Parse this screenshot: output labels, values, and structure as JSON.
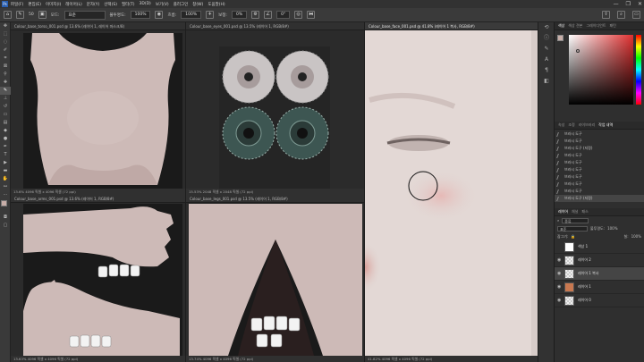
{
  "menubar": {
    "logo": "Ps",
    "items": [
      "파일(F)",
      "편집(E)",
      "이미지(I)",
      "레이어(L)",
      "문자(Y)",
      "선택(S)",
      "필터(T)",
      "3D(D)",
      "보기(V)",
      "플러그인",
      "창(W)",
      "도움말(H)"
    ]
  },
  "window": {
    "minimize": "—",
    "maximize": "❐",
    "close": "✕"
  },
  "options": {
    "brush_size": "50",
    "mode_label": "모드:",
    "mode_value": "표준",
    "opacity_label": "불투명도:",
    "opacity_value": "100%",
    "flow_label": "흐름:",
    "flow_value": "100%",
    "smooth_label": "보정:",
    "smooth_value": "0%",
    "angle_value": "0°"
  },
  "documents": [
    {
      "tab": "Colour_base_torso_001.psd @ 13.6% (레이어 1, 레이어 마스크/8)",
      "status": "13.6%   4096 픽셀 x 4096 픽셀 (72 ppi)"
    },
    {
      "tab": "Colour_base_eyes_001.psd @ 13.5% (레이어 1, RGB/8#)",
      "status": "15.53%   2048 픽셀 x 2048 픽셀 (72 ppi)"
    },
    {
      "tab": "Colour_base_face_001.psd @ 41.8% (레이어 1 복사, RGB/8#)",
      "status": "41.82%   4096 픽셀 x 4096 픽셀 (72 ppi)"
    },
    {
      "tab": "Colour_base_arms_001.psd @ 13.6% (레이어 1, RGB/8#)",
      "status": "13.63%   4096 픽셀 x 4096 픽셀 (72 ppi)"
    },
    {
      "tab": "Colour_base_legs_001.psd @ 13.5% (레이어 1, RGB/8#)",
      "status": "13.74%   4096 픽셀 x 4096 픽셀 (72 ppi)"
    }
  ],
  "color_panel": {
    "tabs": [
      "색상",
      "색상 견본",
      "그레이디언트",
      "패턴"
    ],
    "hue": "#e03030"
  },
  "history_panel": {
    "tabs": [
      "속성",
      "조정",
      "라이브러리",
      "작업 내역"
    ],
    "items": [
      "브러시 도구",
      "브러시 도구",
      "브러시 도구 (지정)",
      "브러시 도구",
      "브러시 도구",
      "브러시 도구",
      "브러시 도구",
      "브러시 도구",
      "브러시 도구",
      "브러시 도구 (지정)"
    ]
  },
  "layers_panel": {
    "tabs": [
      "레이어",
      "채널",
      "패스"
    ],
    "kind_label": "종류",
    "blend_mode": "표준",
    "opacity_label": "불투명도:",
    "opacity_value": "100%",
    "lock_label": "잠그기:",
    "fill_label": "칠:",
    "fill_value": "100%",
    "layers": [
      {
        "name": "색상 1",
        "thumb": "#ffffff",
        "visible": false
      },
      {
        "name": "레이어 2",
        "thumb": "checker",
        "visible": true
      },
      {
        "name": "레이어 1 복사",
        "thumb": "checker",
        "visible": true,
        "selected": true
      },
      {
        "name": "레이어 1",
        "thumb": "#c87850",
        "visible": true
      },
      {
        "name": "레이어 0",
        "thumb": "checker",
        "visible": true
      }
    ]
  }
}
